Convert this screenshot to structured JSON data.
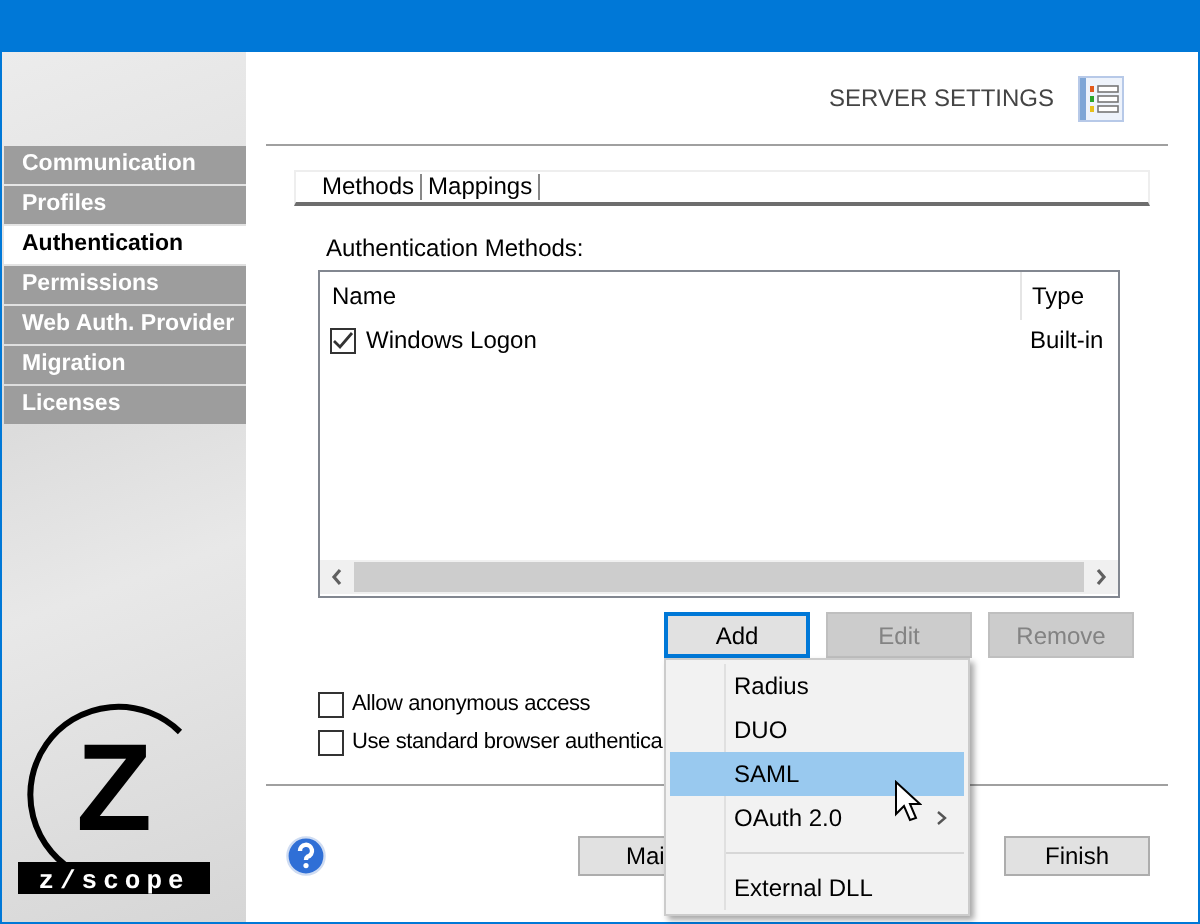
{
  "sidebar": {
    "items": [
      {
        "label": "Communication",
        "selected": false
      },
      {
        "label": "Profiles",
        "selected": false
      },
      {
        "label": "Authentication",
        "selected": true
      },
      {
        "label": "Permissions",
        "selected": false
      },
      {
        "label": "Web Auth. Provider",
        "selected": false
      },
      {
        "label": "Migration",
        "selected": false
      },
      {
        "label": "Licenses",
        "selected": false
      }
    ]
  },
  "logo": {
    "mark": "Z",
    "wordmark": "z/scope"
  },
  "header": {
    "title": "SERVER SETTINGS"
  },
  "tabs": [
    {
      "label": "Methods"
    },
    {
      "label": "Mappings"
    }
  ],
  "methods_label": "Authentication Methods:",
  "table": {
    "columns": [
      "Name",
      "Type"
    ],
    "rows": [
      {
        "name": "Windows Logon",
        "type": "Built-in",
        "checked": true
      }
    ]
  },
  "action_buttons": [
    {
      "label": "Add",
      "focused": true,
      "disabled": false
    },
    {
      "label": "Edit",
      "focused": false,
      "disabled": true
    },
    {
      "label": "Remove",
      "focused": false,
      "disabled": true
    }
  ],
  "options": [
    {
      "label": "Allow anonymous access",
      "checked": false
    },
    {
      "label": "Use standard browser authentica",
      "checked": false
    }
  ],
  "footer_buttons": [
    {
      "label": "Mai"
    },
    {
      "label": "Finish"
    }
  ],
  "menu": {
    "items": [
      {
        "kind": "item",
        "label": "Radius",
        "selected": false,
        "submenu": false
      },
      {
        "kind": "item",
        "label": "DUO",
        "selected": false,
        "submenu": false
      },
      {
        "kind": "item",
        "label": "SAML",
        "selected": true,
        "submenu": false
      },
      {
        "kind": "item",
        "label": "OAuth 2.0",
        "selected": false,
        "submenu": true
      },
      {
        "kind": "separator"
      },
      {
        "kind": "item",
        "label": "External DLL",
        "selected": false,
        "submenu": false
      }
    ]
  }
}
